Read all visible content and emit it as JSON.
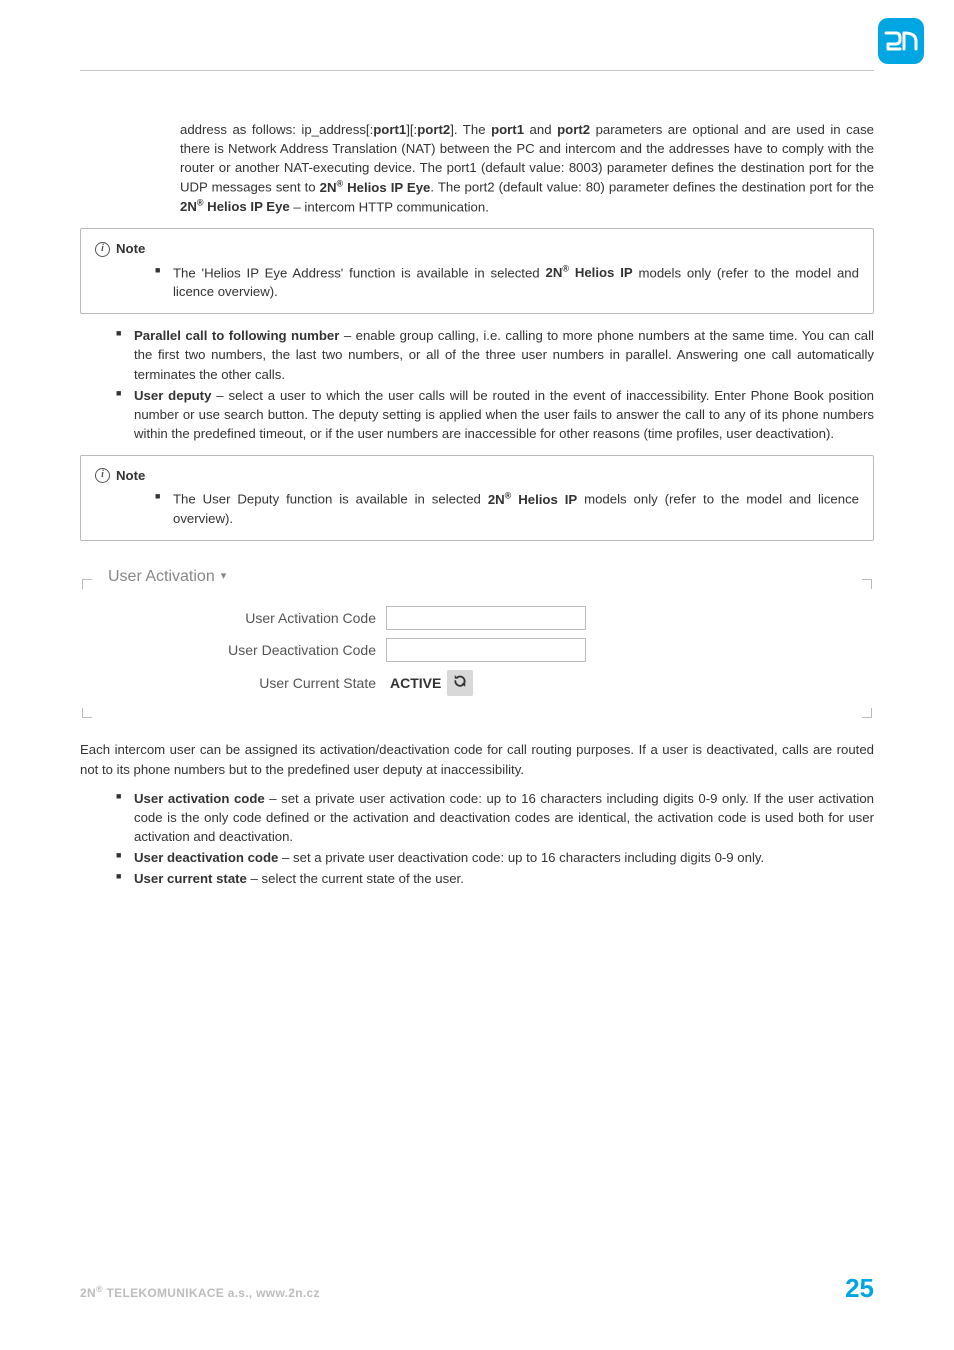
{
  "logo": {
    "name": "brand-logo"
  },
  "para_address": {
    "pre": "address as follows: ip_address[:",
    "port1": "port1",
    "mid1": "][:",
    "port2": "port2",
    "mid2": "]. The ",
    "port1b": "port1",
    "and": " and ",
    "port2b": "port2",
    "rest1": "  parameters are optional and are used in case there is Network Address Translation (NAT) between the PC and intercom and the addresses have to comply with the router or another NAT-executing device. The port1 (default value: 8003) parameter defines the destination port for the UDP messages sent to ",
    "prod1": "2N",
    "reg": "®",
    "prod1b": " Helios IP Eye",
    "rest2": ". The port2 (default value: 80) parameter defines the destination port for the ",
    "prod2": "2N",
    "prod2b": " Helios IP Eye",
    "rest3": " – intercom HTTP communication."
  },
  "note1": {
    "title": "Note",
    "li_pre": "The 'Helios IP Eye Address' function is available in selected ",
    "li_prod": "2N",
    "li_reg": "®",
    "li_prodb": " Helios IP",
    "li_post": " models only (refer to the model and licence overview)."
  },
  "bulletA": {
    "b": "Parallel call to following number",
    "t": " – enable group calling, i.e. calling to more phone numbers at the same time. You can call the first two numbers, the last two numbers, or all of the three user numbers in parallel. Answering one call automatically terminates the other calls."
  },
  "bulletB": {
    "b": "User deputy",
    "t": " – select a user to which the user calls will be routed in the event of inaccessibility. Enter Phone Book position number or use search button. The deputy setting is applied when the user fails to answer the call to any of its phone numbers within the predefined timeout, or if the user numbers are inaccessible for other reasons (time profiles, user deactivation)."
  },
  "note2": {
    "title": "Note",
    "li_pre": "The User Deputy function is available in selected ",
    "li_prod": "2N",
    "li_reg": "®",
    "li_prodb": " Helios IP",
    "li_post": " models only (refer to the model and licence overview)."
  },
  "fieldset": {
    "legend": "User Activation",
    "row1_label": "User Activation Code",
    "row1_value": "",
    "row2_label": "User Deactivation Code",
    "row2_value": "",
    "row3_label": "User Current State",
    "row3_value": "ACTIVE",
    "toggle_glyph": "↻"
  },
  "para_each": "Each intercom user can be assigned its activation/deactivation code for call routing purposes. If a user is deactivated, calls are routed not to its phone numbers but to the predefined user deputy at inaccessibility.",
  "bulletC": {
    "b": "User activation code",
    "t": " – set a private user activation code: up to 16 characters including digits 0-9 only. If the user activation code is the only code defined or the activation and deactivation codes are identical, the activation code is used both for user activation and deactivation."
  },
  "bulletD": {
    "b": "User deactivation code",
    "t": " – set a private user deactivation code: up to 16 characters including digits 0-9 only."
  },
  "bulletE": {
    "b": "User current state",
    "t": " – select the current state of the user."
  },
  "footer": {
    "left_pre": "2N",
    "left_reg": "®",
    "left_post": " TELEKOMUNIKACE a.s., www.2n.cz",
    "page": "25"
  }
}
